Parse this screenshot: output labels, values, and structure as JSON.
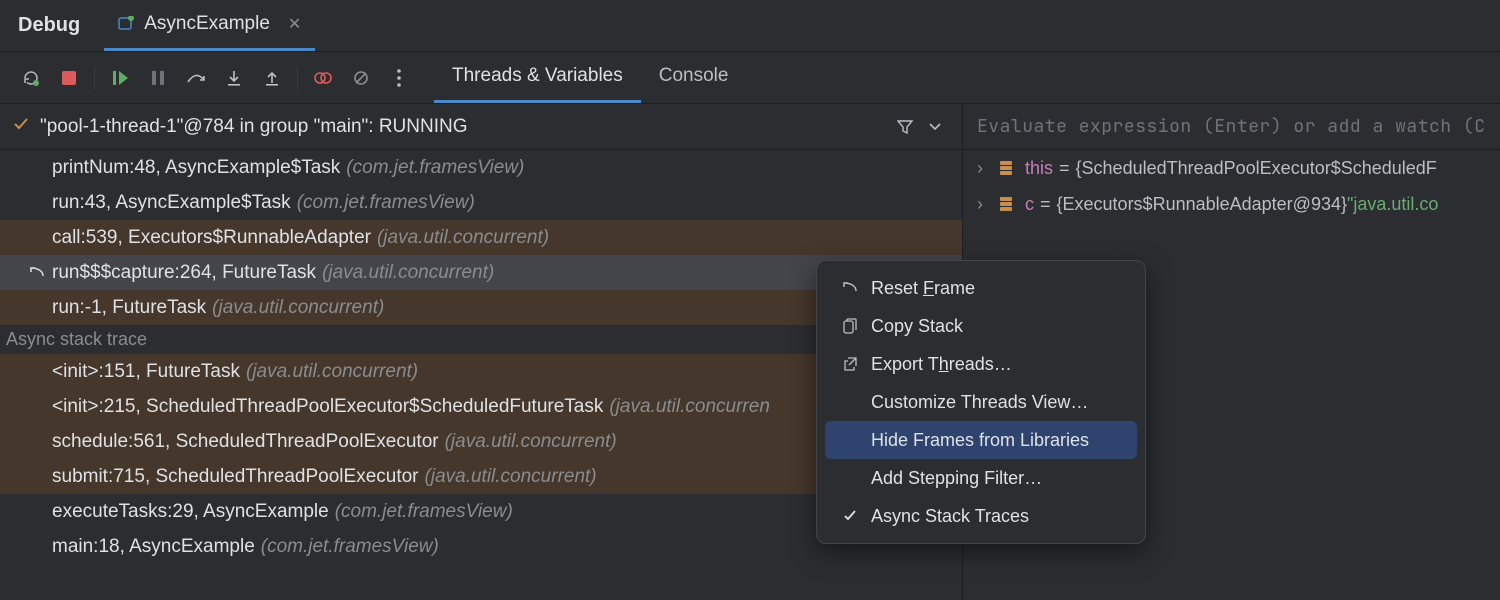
{
  "header": {
    "panel_label": "Debug",
    "tab_title": "AsyncExample"
  },
  "subtabs": {
    "threads": "Threads & Variables",
    "console": "Console"
  },
  "thread": {
    "title": "\"pool-1-thread-1\"@784 in group \"main\": RUNNING"
  },
  "frames": [
    {
      "method": "printNum:48, AsyncExample$Task",
      "pkg": "(com.jet.framesView)",
      "lib": false
    },
    {
      "method": "run:43, AsyncExample$Task",
      "pkg": "(com.jet.framesView)",
      "lib": false
    },
    {
      "method": "call:539, Executors$RunnableAdapter",
      "pkg": "(java.util.concurrent)",
      "lib": true
    },
    {
      "method": "run$$$capture:264, FutureTask",
      "pkg": "(java.util.concurrent)",
      "lib": true,
      "selected": true,
      "icon": "reset"
    },
    {
      "method": "run:-1, FutureTask",
      "pkg": "(java.util.concurrent)",
      "lib": true
    }
  ],
  "section_label": "Async stack trace",
  "async_frames": [
    {
      "method": "<init>:151, FutureTask",
      "pkg": "(java.util.concurrent)",
      "lib": true
    },
    {
      "method": "<init>:215, ScheduledThreadPoolExecutor$ScheduledFutureTask",
      "pkg": "(java.util.concurren",
      "lib": true
    },
    {
      "method": "schedule:561, ScheduledThreadPoolExecutor",
      "pkg": "(java.util.concurrent)",
      "lib": true
    },
    {
      "method": "submit:715, ScheduledThreadPoolExecutor",
      "pkg": "(java.util.concurrent)",
      "lib": true
    },
    {
      "method": "executeTasks:29, AsyncExample",
      "pkg": "(com.jet.framesView)",
      "lib": false
    },
    {
      "method": "main:18, AsyncExample",
      "pkg": "(com.jet.framesView)",
      "lib": false
    }
  ],
  "eval_placeholder": "Evaluate expression (Enter) or add a watch (C",
  "variables": [
    {
      "name": "this",
      "value_prefix": "= ",
      "value": "{ScheduledThreadPoolExecutor$ScheduledF"
    },
    {
      "name": "c",
      "value_prefix": "= ",
      "value": "{Executors$RunnableAdapter@934} ",
      "string": "\"java.util.co"
    }
  ],
  "menu": {
    "reset_pre": "Reset ",
    "reset_u": "F",
    "reset_post": "rame",
    "copy": "Copy Stack",
    "export_pre": "Export T",
    "export_u": "h",
    "export_post": "reads…",
    "customize": "Customize Threads View…",
    "hide": "Hide Frames from Libraries",
    "filter": "Add Stepping Filter…",
    "async": "Async Stack Traces"
  }
}
